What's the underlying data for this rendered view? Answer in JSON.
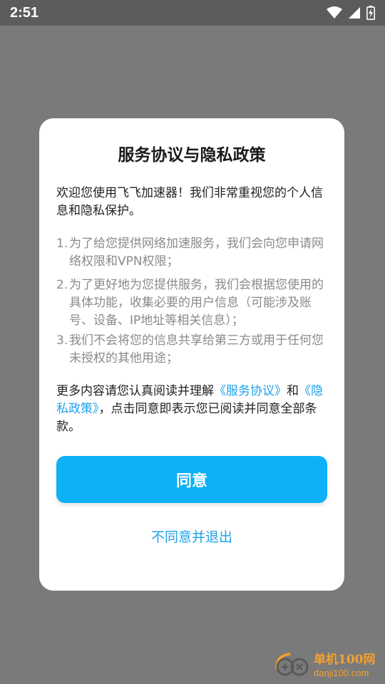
{
  "status_bar": {
    "time": "2:51",
    "icons": [
      "wifi-icon",
      "cell-signal-icon",
      "battery-charging-icon"
    ]
  },
  "dialog": {
    "title": "服务协议与隐私政策",
    "intro": "欢迎您使用飞飞加速器！我们非常重视您的个人信息和隐私保护。",
    "terms": [
      {
        "num": "1.",
        "text": "为了给您提供网络加速服务，我们会向您申请网络权限和VPN权限；"
      },
      {
        "num": "2.",
        "text": "为了更好地为您提供服务，我们会根据您使用的具体功能，收集必要的用户信息（可能涉及账号、设备、IP地址等相关信息）；"
      },
      {
        "num": "3.",
        "text": "我们不会将您的信息共享给第三方或用于任何您未授权的其他用途；"
      }
    ],
    "footer": {
      "prefix": "更多内容请您认真阅读并理解",
      "service_link": "《服务协议》",
      "and": "和",
      "privacy_link": "《隐私政策》",
      "suffix": "，点击同意即表示您已阅读并同意全部条款。"
    },
    "agree_label": "同意",
    "decline_label": "不同意并退出"
  },
  "watermark": {
    "name": "单机100网",
    "domain": "danji100.com"
  },
  "colors": {
    "accent": "#0eb0f6",
    "link": "#1ea2e8",
    "overlay": "#7a7a7a",
    "status_bar": "#5c5c5c"
  }
}
